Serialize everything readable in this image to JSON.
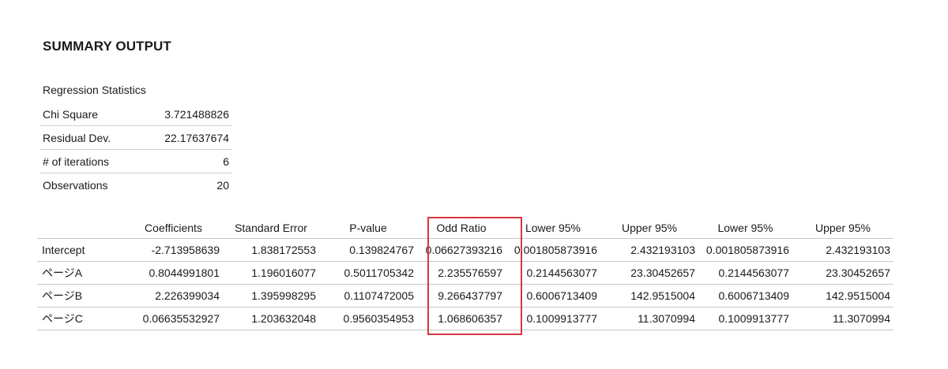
{
  "title": "SUMMARY OUTPUT",
  "regression_statistics": {
    "label": "Regression Statistics",
    "rows": [
      {
        "name": "Chi Square",
        "value": "3.721488826"
      },
      {
        "name": "Residual Dev.",
        "value": "22.17637674"
      },
      {
        "name": "# of iterations",
        "value": "6"
      },
      {
        "name": "Observations",
        "value": "20"
      }
    ]
  },
  "coefficients_table": {
    "headers": [
      "",
      "Coefficients",
      "Standard Error",
      "P-value",
      "Odd Ratio",
      "Lower 95%",
      "Upper 95%",
      "Lower 95%",
      "Upper 95%"
    ],
    "rows": [
      [
        "Intercept",
        "-2.713958639",
        "1.838172553",
        "0.139824767",
        "0.06627393216",
        "0.001805873916",
        "2.432193103",
        "0.001805873916",
        "2.432193103"
      ],
      [
        "ページA",
        "0.8044991801",
        "1.196016077",
        "0.5011705342",
        "2.235576597",
        "0.2144563077",
        "23.30452657",
        "0.2144563077",
        "23.30452657"
      ],
      [
        "ページB",
        "2.226399034",
        "1.395998295",
        "0.1107472005",
        "9.266437797",
        "0.6006713409",
        "142.9515004",
        "0.6006713409",
        "142.9515004"
      ],
      [
        "ページC",
        "0.06635532927",
        "1.203632048",
        "0.9560354953",
        "1.068606357",
        "0.1009913777",
        "11.3070994",
        "0.1009913777",
        "11.3070994"
      ]
    ],
    "highlighted_column": "Odd Ratio",
    "highlight_color": "#d9363e"
  }
}
